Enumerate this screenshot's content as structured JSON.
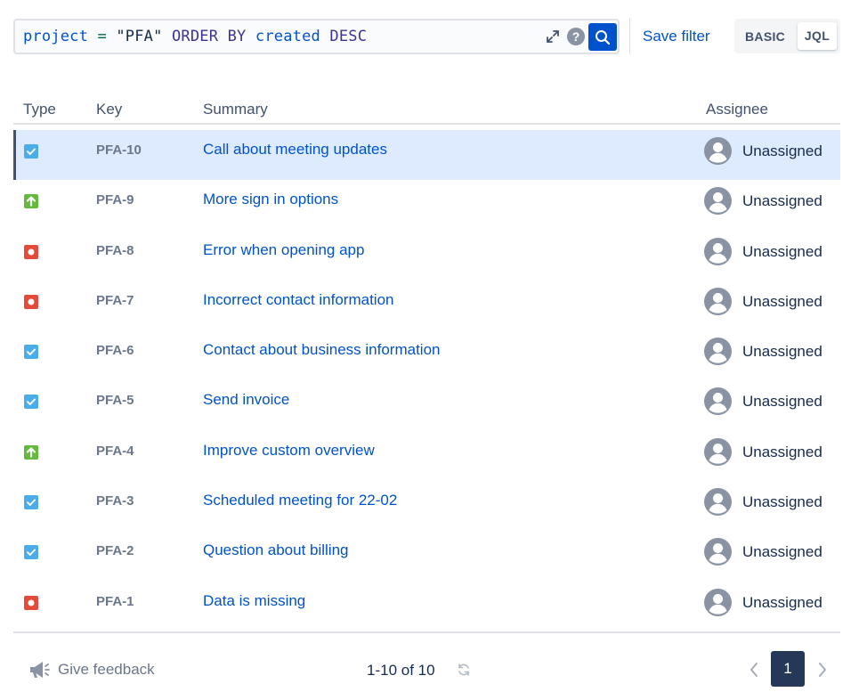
{
  "search": {
    "query_tokens": [
      {
        "text": "project",
        "kind": "kw"
      },
      {
        "text": " = ",
        "kind": "op"
      },
      {
        "text": "\"PFA\"",
        "kind": "str"
      },
      {
        "text": " ORDER BY ",
        "kind": "ord"
      },
      {
        "text": "created",
        "kind": "kw"
      },
      {
        "text": " DESC",
        "kind": "ord"
      }
    ],
    "help_glyph": "?"
  },
  "toolbar": {
    "save_filter_label": "Save filter",
    "mode_basic_label": "BASIC",
    "mode_jql_label": "JQL",
    "active_mode": "JQL"
  },
  "table": {
    "columns": {
      "type": "Type",
      "key": "Key",
      "summary": "Summary",
      "assignee": "Assignee"
    },
    "rows": [
      {
        "type": "task",
        "key": "PFA-10",
        "summary": "Call about meeting updates",
        "assignee": "Unassigned",
        "selected": true
      },
      {
        "type": "improvement",
        "key": "PFA-9",
        "summary": "More sign in options",
        "assignee": "Unassigned"
      },
      {
        "type": "bug",
        "key": "PFA-8",
        "summary": "Error when opening app",
        "assignee": "Unassigned"
      },
      {
        "type": "bug",
        "key": "PFA-7",
        "summary": "Incorrect contact information",
        "assignee": "Unassigned"
      },
      {
        "type": "task",
        "key": "PFA-6",
        "summary": "Contact about business information",
        "assignee": "Unassigned"
      },
      {
        "type": "task",
        "key": "PFA-5",
        "summary": "Send invoice",
        "assignee": "Unassigned"
      },
      {
        "type": "improvement",
        "key": "PFA-4",
        "summary": "Improve custom overview",
        "assignee": "Unassigned"
      },
      {
        "type": "task",
        "key": "PFA-3",
        "summary": "Scheduled meeting for 22-02",
        "assignee": "Unassigned"
      },
      {
        "type": "task",
        "key": "PFA-2",
        "summary": "Question about billing",
        "assignee": "Unassigned"
      },
      {
        "type": "bug",
        "key": "PFA-1",
        "summary": "Data is missing",
        "assignee": "Unassigned"
      }
    ]
  },
  "footer": {
    "feedback_label": "Give feedback",
    "count_label": "1-10 of 10",
    "current_page": "1"
  },
  "colors": {
    "task": "#4bade8",
    "improvement": "#63ba3c",
    "bug": "#e5493a",
    "link": "#0052cc",
    "selected_row": "#deebff"
  },
  "icons": {
    "expand": "expand-icon",
    "help": "help-icon",
    "search": "search-icon",
    "avatar": "avatar-icon",
    "feedback": "megaphone-icon",
    "refresh": "refresh-icon",
    "prev": "chevron-left-icon",
    "next": "chevron-right-icon"
  }
}
